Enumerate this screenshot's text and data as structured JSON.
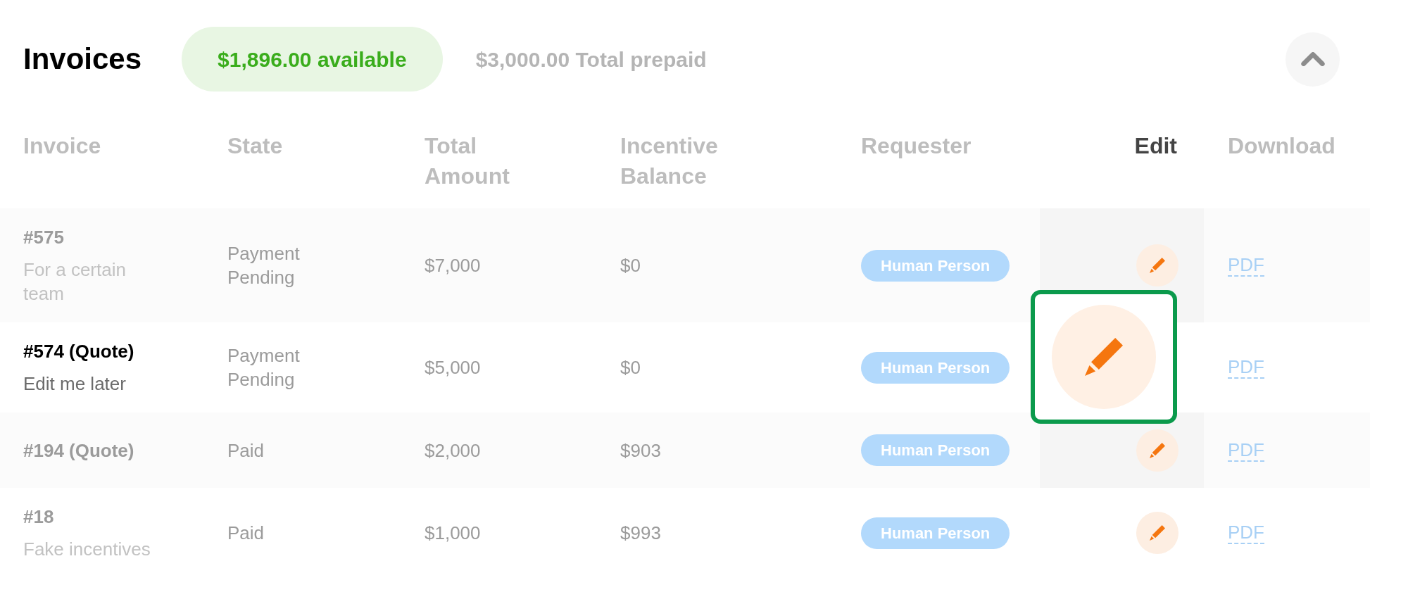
{
  "header": {
    "title": "Invoices",
    "available_balance": "$1,896.00 available",
    "total_prepaid": "$3,000.00 Total prepaid",
    "expanded": true
  },
  "columns": [
    {
      "label": "Invoice",
      "selected": false
    },
    {
      "label": "State",
      "selected": false
    },
    {
      "label": "Total Amount",
      "selected": false
    },
    {
      "label": "Incentive Balance",
      "selected": false
    },
    {
      "label": "Requester",
      "selected": false
    },
    {
      "label": "Edit",
      "selected": true
    },
    {
      "label": "Download",
      "selected": false
    }
  ],
  "rows": [
    {
      "invoice": "#575",
      "description": "For a certain team",
      "state": "Payment Pending",
      "total_amount": "$7,000",
      "incentive_balance": "$0",
      "requester": "Human Person",
      "download": "PDF",
      "highlighted": false
    },
    {
      "invoice": "#574 (Quote)",
      "description": "Edit me later",
      "state": "Payment Pending",
      "total_amount": "$5,000",
      "incentive_balance": "$0",
      "requester": "Human Person",
      "download": "PDF",
      "highlighted": true
    },
    {
      "invoice": "#194 (Quote)",
      "state": "Paid",
      "total_amount": "$2,000",
      "incentive_balance": "$903",
      "requester": "Human Person",
      "download": "PDF",
      "highlighted": false
    },
    {
      "invoice": "#18",
      "description": "Fake incentives",
      "state": "Paid",
      "total_amount": "$1,000",
      "incentive_balance": "$993",
      "requester": "Human Person",
      "download": "PDF",
      "highlighted": false
    }
  ]
}
